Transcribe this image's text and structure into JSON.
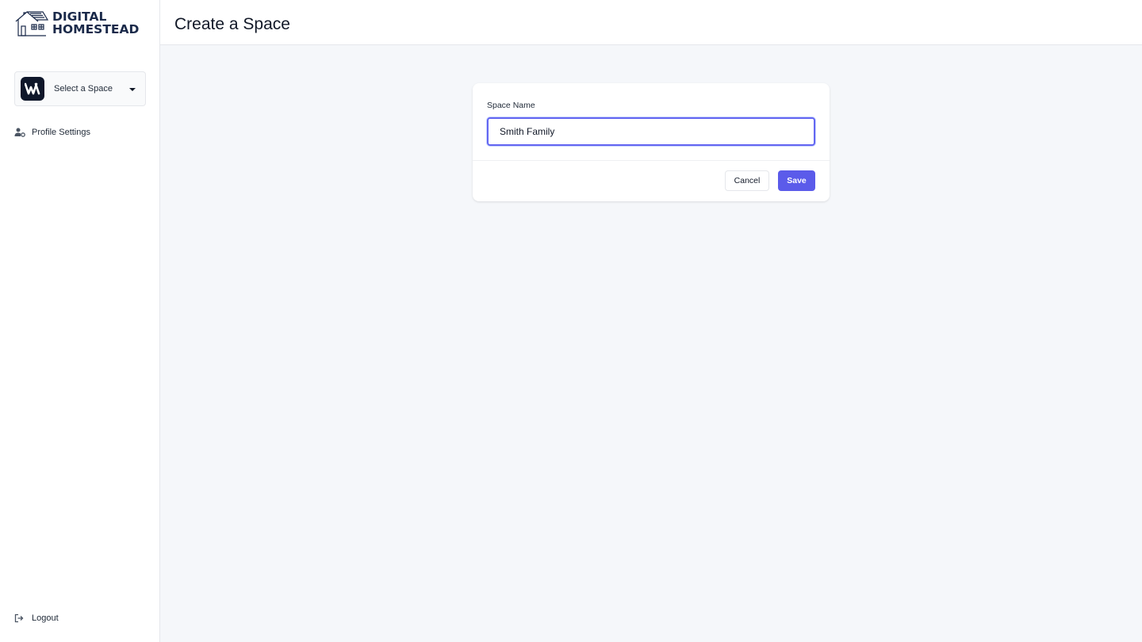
{
  "app": {
    "logo_line1": "DIGITAL",
    "logo_line2": "HOMESTEAD",
    "logo_icon": "house-icon"
  },
  "sidebar": {
    "space_selector": {
      "label": "Select a Space",
      "avatar_icon": "workspace-w-icon",
      "caret_icon": "caret-down-icon"
    },
    "items": [
      {
        "label": "Profile Settings",
        "icon": "user-cog-icon"
      }
    ],
    "footer": {
      "label": "Logout",
      "icon": "logout-icon"
    }
  },
  "header": {
    "title": "Create a Space"
  },
  "form": {
    "space_name_label": "Space Name",
    "space_name_value": "Smith Family",
    "cancel_label": "Cancel",
    "save_label": "Save"
  },
  "colors": {
    "accent": "#5b5bea",
    "focus_border": "#6366f1",
    "sidebar_bg": "#ffffff",
    "content_bg": "#f5f7fa",
    "brand_navy": "#1b2a4a"
  }
}
